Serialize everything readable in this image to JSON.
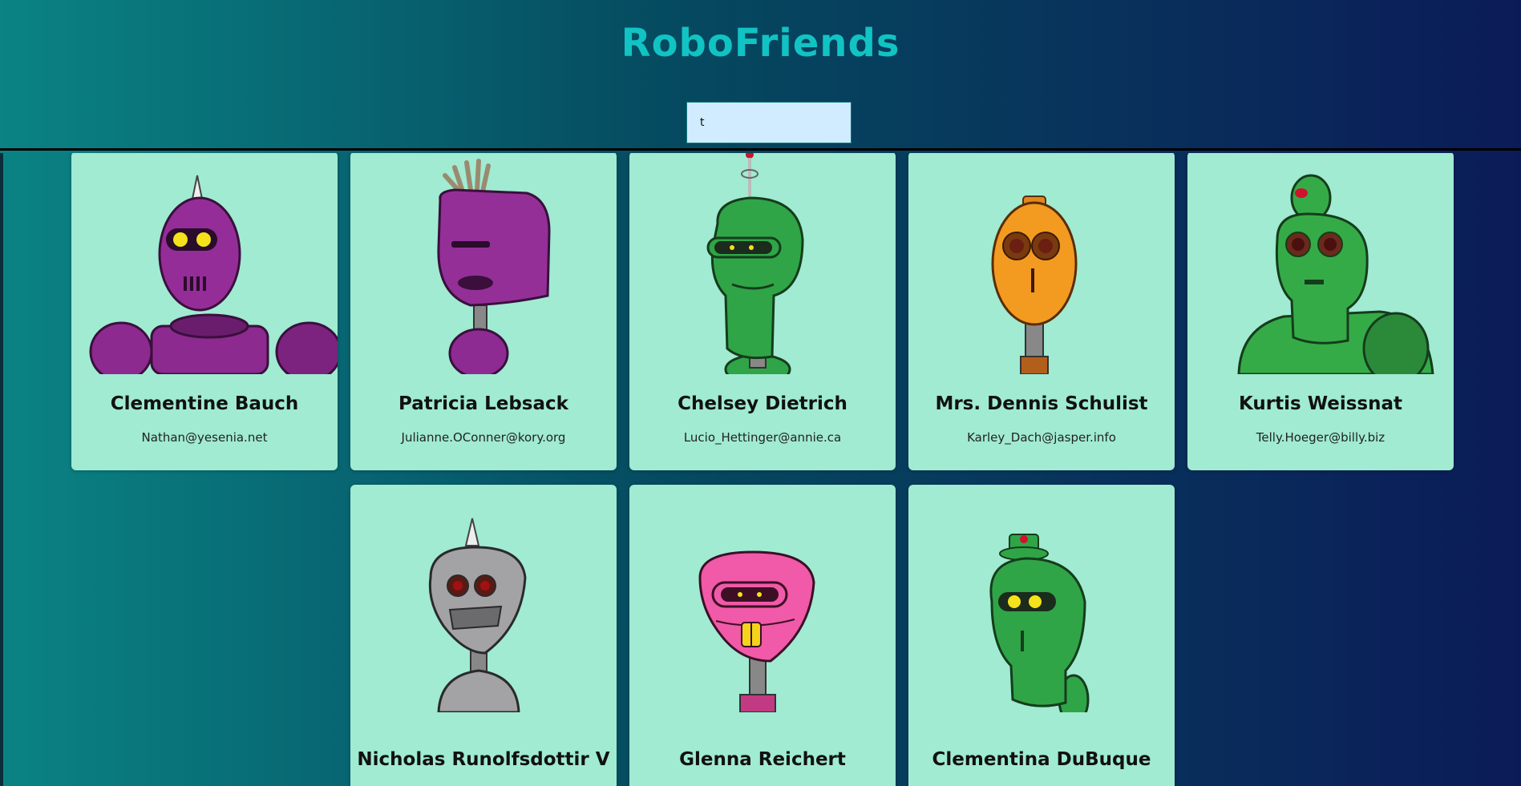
{
  "app": {
    "title": "RoboFriends"
  },
  "search": {
    "value": "t",
    "placeholder": ""
  },
  "robots": [
    {
      "name": "Clementine Bauch",
      "email": "Nathan@yesenia.net",
      "color": "#8c2a8f",
      "icon": "robot-purple-spike"
    },
    {
      "name": "Patricia Lebsack",
      "email": "Julianne.OConner@kory.org",
      "color": "#8e2b92",
      "icon": "robot-purple-block"
    },
    {
      "name": "Chelsey Dietrich",
      "email": "Lucio_Hettinger@annie.ca",
      "color": "#2fa547",
      "icon": "robot-green-antenna"
    },
    {
      "name": "Mrs. Dennis Schulist",
      "email": "Karley_Dach@jasper.info",
      "color": "#f39a21",
      "icon": "robot-orange-seven"
    },
    {
      "name": "Kurtis Weissnat",
      "email": "Telly.Hoeger@billy.biz",
      "color": "#35ab48",
      "icon": "robot-green-dome"
    },
    {
      "name": "Nicholas Runolfsdottir V",
      "email": "",
      "color": "#a3a3a6",
      "icon": "robot-gray-spike"
    },
    {
      "name": "Glenna Reichert",
      "email": "",
      "color": "#f05aa8",
      "icon": "robot-pink-visor"
    },
    {
      "name": "Clementina DuBuque",
      "email": "",
      "color": "#2fa547",
      "icon": "robot-green-hat"
    }
  ]
}
